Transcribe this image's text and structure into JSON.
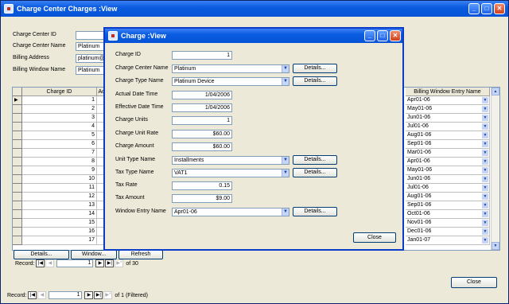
{
  "main": {
    "title": "Charge Center Charges :View",
    "labels": {
      "charge_center_id": "Charge Center ID",
      "charge_center_name": "Charge Center Name",
      "billing_address": "Billing Address",
      "billing_window_name": "Billing Window Name"
    },
    "values": {
      "charge_center_name": "Platinum",
      "billing_address": "platinum@",
      "billing_window_name": "Platinum"
    },
    "grid": {
      "col_charge_id": "Charge ID",
      "col_act": "Act",
      "col_bwen": "Billing Window Entry Name",
      "ids": [
        "1",
        "2",
        "3",
        "4",
        "5",
        "6",
        "7",
        "8",
        "9",
        "10",
        "11",
        "12",
        "13",
        "14",
        "15",
        "16",
        "17"
      ],
      "entries": [
        "Apr01-06",
        "May01-06",
        "Jun01-06",
        "Jul01-06",
        "Aug01-06",
        "Sep01-06",
        "Mar01-06",
        "Apr01-06",
        "May01-06",
        "Jun01-06",
        "Jul01-06",
        "Aug01-06",
        "Sep01-06",
        "Oct01-06",
        "Nov01-06",
        "Dec01-06",
        "Jan01-07"
      ]
    },
    "buttons": {
      "details": "Details...",
      "window": "Window...",
      "refresh": "Refresh",
      "close": "Close"
    },
    "record_nav": {
      "label": "Record:",
      "current": "1",
      "of": "of",
      "total": "30"
    },
    "bottom_nav": {
      "label": "Record:",
      "current": "1",
      "of": "of",
      "total_text": "1 (Filtered)"
    }
  },
  "dialog": {
    "title": "Charge :View",
    "fields": {
      "charge_id": {
        "label": "Charge ID",
        "value": "1"
      },
      "charge_center_name": {
        "label": "Charge Center Name",
        "value": "Platinum"
      },
      "charge_type_name": {
        "label": "Charge Type Name",
        "value": "Platinum Device"
      },
      "actual_date_time": {
        "label": "Actual Date Time",
        "value": "1/04/2006"
      },
      "effective_date_time": {
        "label": "Effective Date Time",
        "value": "1/04/2006"
      },
      "charge_units": {
        "label": "Charge Units",
        "value": "1"
      },
      "charge_unit_rate": {
        "label": "Charge Unit Rate",
        "value": "$60.00"
      },
      "charge_amount": {
        "label": "Charge Amount",
        "value": "$60.00"
      },
      "unit_type_name": {
        "label": "Unit Type Name",
        "value": "Installments"
      },
      "tax_type_name": {
        "label": "Tax Type Name",
        "value": "VAT1"
      },
      "tax_rate": {
        "label": "Tax Rate",
        "value": "0.15"
      },
      "tax_amount": {
        "label": "Tax Amount",
        "value": "$9.00"
      },
      "window_entry_name": {
        "label": "Window Entry Name",
        "value": "Apr01-06"
      }
    },
    "details_label": "Details...",
    "close_label": "Close"
  }
}
